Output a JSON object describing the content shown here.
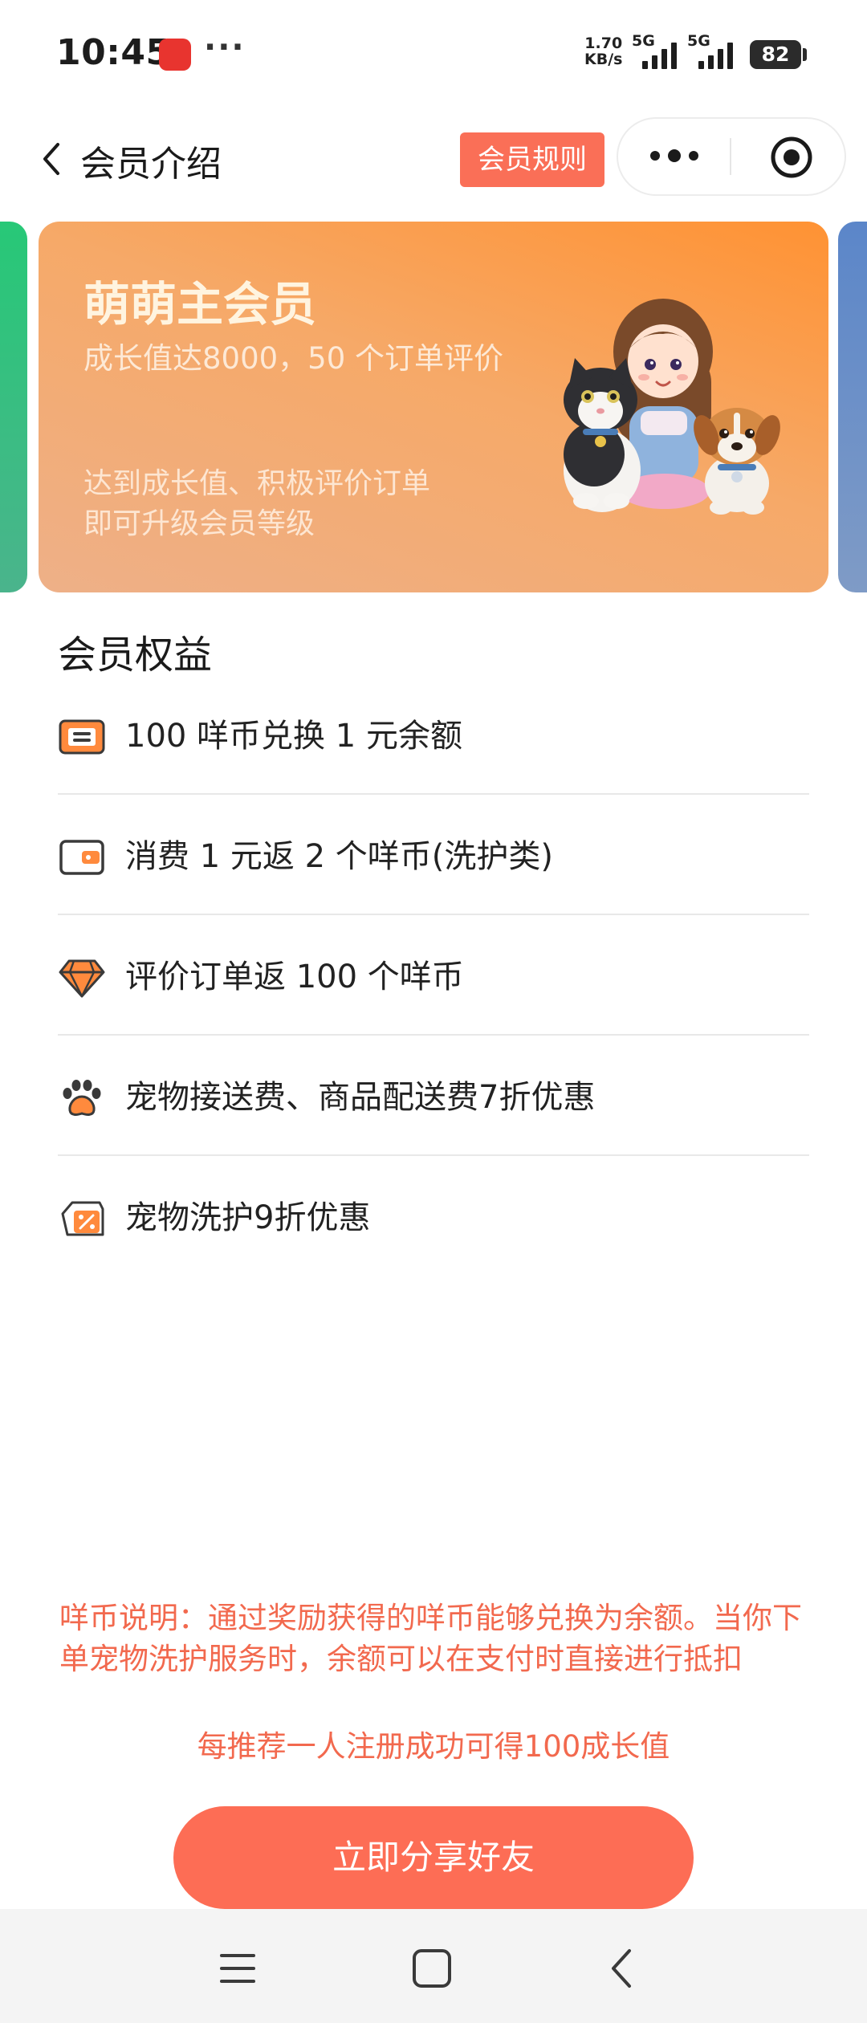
{
  "status_bar": {
    "time": "10:45",
    "more": "···",
    "net_speed_value": "1.70",
    "net_speed_unit": "KB/s",
    "sim1": "5G",
    "sim2": "5G",
    "battery": "82"
  },
  "nav": {
    "title": "会员介绍",
    "rules_button": "会员规则"
  },
  "card": {
    "title": "萌萌主会员",
    "requirement": "成长值达8000，50 个订单评价",
    "description": "达到成长值、积极评价订单即可升级会员等级"
  },
  "benefits": {
    "heading": "会员权益",
    "items": [
      {
        "icon": "coupon-icon",
        "text": "100 咩币兑换 1 元余额"
      },
      {
        "icon": "wallet-icon",
        "text": "消费 1 元返 2 个咩币(洗护类)"
      },
      {
        "icon": "diamond-icon",
        "text": "评价订单返 100 个咩币"
      },
      {
        "icon": "paw-icon",
        "text": "宠物接送费、商品配送费7折优惠"
      },
      {
        "icon": "discount-tag-icon",
        "text": "宠物洗护9折优惠"
      }
    ]
  },
  "footer": {
    "coin_note": "咩币说明：通过奖励获得的咩币能够兑换为余额。当你下单宠物洗护服务时，余额可以在支付时直接进行抵扣",
    "referral_note": "每推荐一人注册成功可得100成长值",
    "share_button": "立即分享好友"
  },
  "colors": {
    "accent": "#fd6d55",
    "card_orange": "#ff9233",
    "note_text": "#f2694e"
  }
}
